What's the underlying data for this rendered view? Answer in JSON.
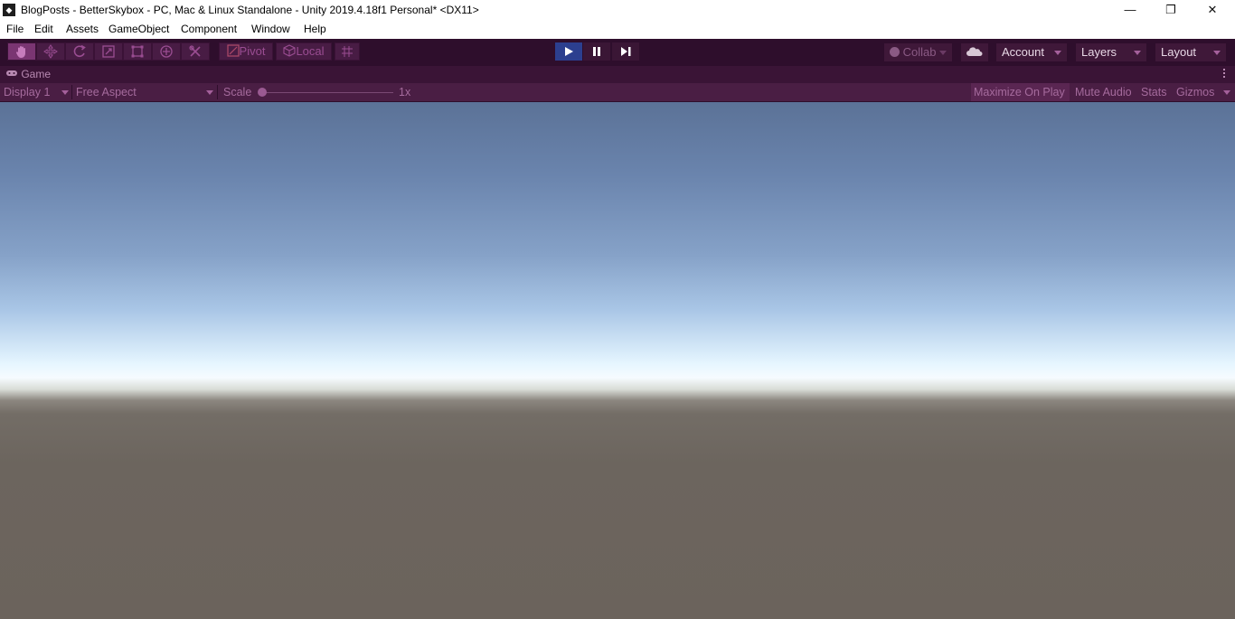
{
  "window": {
    "title": "BlogPosts - BetterSkybox - PC, Mac & Linux Standalone - Unity 2019.4.18f1 Personal* <DX11>",
    "minimize_glyph": "—",
    "restore_glyph": "❐",
    "close_glyph": "✕"
  },
  "menu": {
    "items": [
      "File",
      "Edit",
      "Assets",
      "GameObject",
      "Component",
      "Window",
      "Help"
    ]
  },
  "toolbar": {
    "pivot_label": "Pivot",
    "local_label": "Local",
    "collab_label": "Collab",
    "account_label": "Account",
    "layers_label": "Layers",
    "layout_label": "Layout",
    "tools": [
      "hand-icon",
      "move-icon",
      "rotate-icon",
      "scale-icon",
      "rect-icon",
      "transform-icon",
      "custom-tool-icon"
    ],
    "active_tool": "hand-icon"
  },
  "game_tab": {
    "label": "Game"
  },
  "game_options": {
    "display": "Display 1",
    "aspect": "Free Aspect",
    "scale_label": "Scale",
    "scale_value": "1x",
    "maximize_label": "Maximize On Play",
    "mute_label": "Mute Audio",
    "stats_label": "Stats",
    "gizmos_label": "Gizmos"
  },
  "colors": {
    "toolbar_bg": "#2e0e2c",
    "accent": "#9a4d92",
    "play_active": "#2c3f8f"
  }
}
